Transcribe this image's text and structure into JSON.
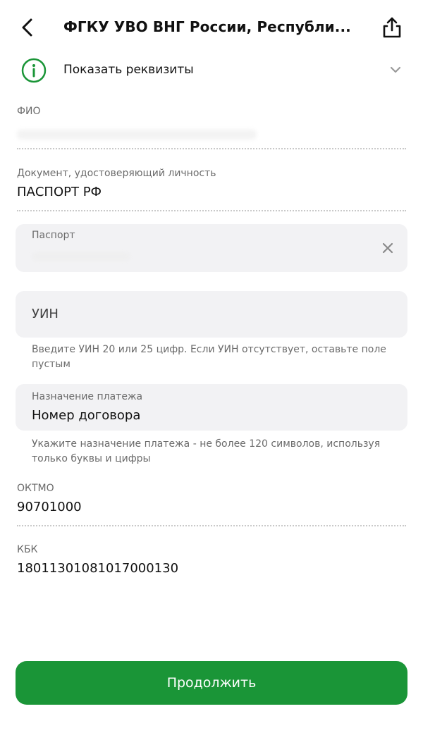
{
  "header": {
    "title": "ФГКУ УВО ВНГ России, Республи..."
  },
  "requisites": {
    "label": "Показать реквизиты"
  },
  "fields": {
    "fio": {
      "label": "ФИО",
      "value": ""
    },
    "document": {
      "label": "Документ, удостоверяющий личность",
      "value": "ПАСПОРТ РФ"
    },
    "passport": {
      "label": "Паспорт",
      "value": ""
    },
    "uin": {
      "placeholder": "УИН",
      "hint": "Введите УИН 20 или 25 цифр. Если УИН отсутствует, оставьте поле пустым"
    },
    "purpose": {
      "label": "Назначение платежа",
      "value": "Номер договора",
      "hint": "Укажите назначение платежа - не более 120 символов, используя только буквы и цифры"
    },
    "oktmo": {
      "label": "ОКТМО",
      "value": "90701000"
    },
    "kbk": {
      "label": "КБК",
      "value": "18011301081017000130"
    }
  },
  "continue_button": {
    "label": "Продолжить"
  },
  "colors": {
    "accent": "#1a9537",
    "field_bg": "#f2f2f4",
    "label": "#6b6b6b"
  },
  "icons": {
    "back": "arrow-left-icon",
    "share": "share-icon",
    "info": "info-icon",
    "chevron": "chevron-down-icon",
    "clear": "close-icon"
  }
}
